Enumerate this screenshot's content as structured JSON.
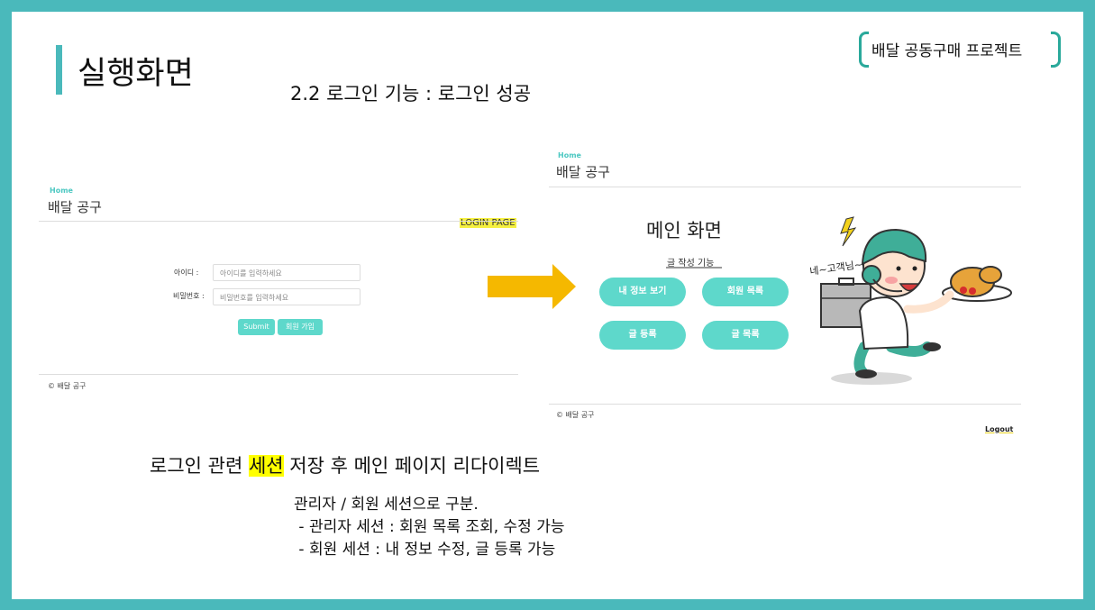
{
  "slide": {
    "title": "실행화면",
    "project": "배달 공동구매 프로젝트",
    "section_heading": "2.2 로그인 기능 : 로그인 성공"
  },
  "login_shot": {
    "home": "Home",
    "app_name": "배달 공구",
    "page_tag": "LOGIN PAGE",
    "id_label": "아이디 :",
    "id_placeholder": "아이디를 입력하세요",
    "pw_label": "비밀번호 :",
    "pw_placeholder": "비밀번호를 입력하세요",
    "submit": "Submit",
    "signup": "회원 가입",
    "footer": "© 배달 공구"
  },
  "main_shot": {
    "home": "Home",
    "app_name": "배달 공구",
    "title": "메인 화면",
    "write_link": "글 작성 기능",
    "buttons": [
      "내 정보 보기",
      "회원 목록",
      "글 등록",
      "글 목록"
    ],
    "footer": "© 배달 공구",
    "logout": "Logout",
    "mascot_text": "네~고객님~"
  },
  "summary": {
    "before": "로그인 관련 ",
    "highlight": "세션",
    "after": " 저장 후 메인 페이지 리다이렉트"
  },
  "notes": [
    "관리자 / 회원 세션으로 구분.",
    " - 관리자 세션 : 회원 목록 조회, 수정 가능",
    " - 회원 세션 : 내 정보 수정, 글 등록 가능"
  ],
  "colors": {
    "frame": "#4ab9bb",
    "button": "#5ed8cb",
    "arrow": "#f5b800",
    "highlight": "#ffff00"
  }
}
